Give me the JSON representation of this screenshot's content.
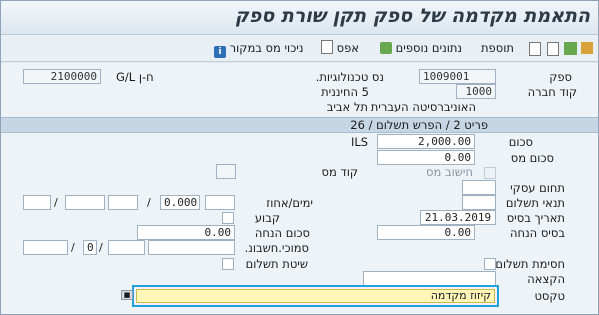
{
  "window": {
    "title": "התאמת מקדמה של ספק תקן שורת ספק"
  },
  "toolbar": {
    "withholding_tax_label": "ניכוי מס במקור",
    "reset_label": "אפס",
    "additional_data_label": "נתונים נוספים",
    "addition_label": "תוספת"
  },
  "header": {
    "vendor_label": "ספק",
    "vendor_value": "1009001",
    "vendor_name": "נס טכנולוגיות.",
    "company_code_label": "קוד חברה",
    "company_code_value": "1000",
    "city_label": "5 החיננית",
    "university": "האוניברסיטה העברית",
    "city": "תל אביב",
    "gl_label": "G/L ח-ן",
    "gl_value": "2100000"
  },
  "item_bar": {
    "text": "פריט 2 / הפרש תשלום / 26"
  },
  "amounts": {
    "amount_label": "סכום",
    "amount_value": "2,000.00",
    "currency": "ILS",
    "tax_amount_label": "סכום מס",
    "tax_amount_value": "0.00",
    "calc_tax_label": "חישוב מס",
    "tax_code_label": "קוד מס"
  },
  "fields": {
    "business_area_label": "תחום עסקי",
    "payment_terms_label": "תנאי תשלום",
    "days_percent_label": "ימים/אחוז",
    "discount_value": "0.000",
    "baseline_date_label": "תאריך בסיס",
    "baseline_date_value": "21.03.2019",
    "fixed_label": "קבוע",
    "discount_base_label": "בסיס הנחה",
    "discount_base_value": "0.00",
    "discount_amount_label": "סכום הנחה",
    "discount_amount_value": "0.00",
    "invoice_ref_label": "סמוכי.חשבונ.",
    "invoice_ref_value": "0",
    "payment_block_label": "חסימת תשלום",
    "payment_method_label": "שיטת תשלום",
    "assignment_label": "הקצאה",
    "text_label": "טקסט",
    "text_value": "קיזוז מקדמה"
  }
}
